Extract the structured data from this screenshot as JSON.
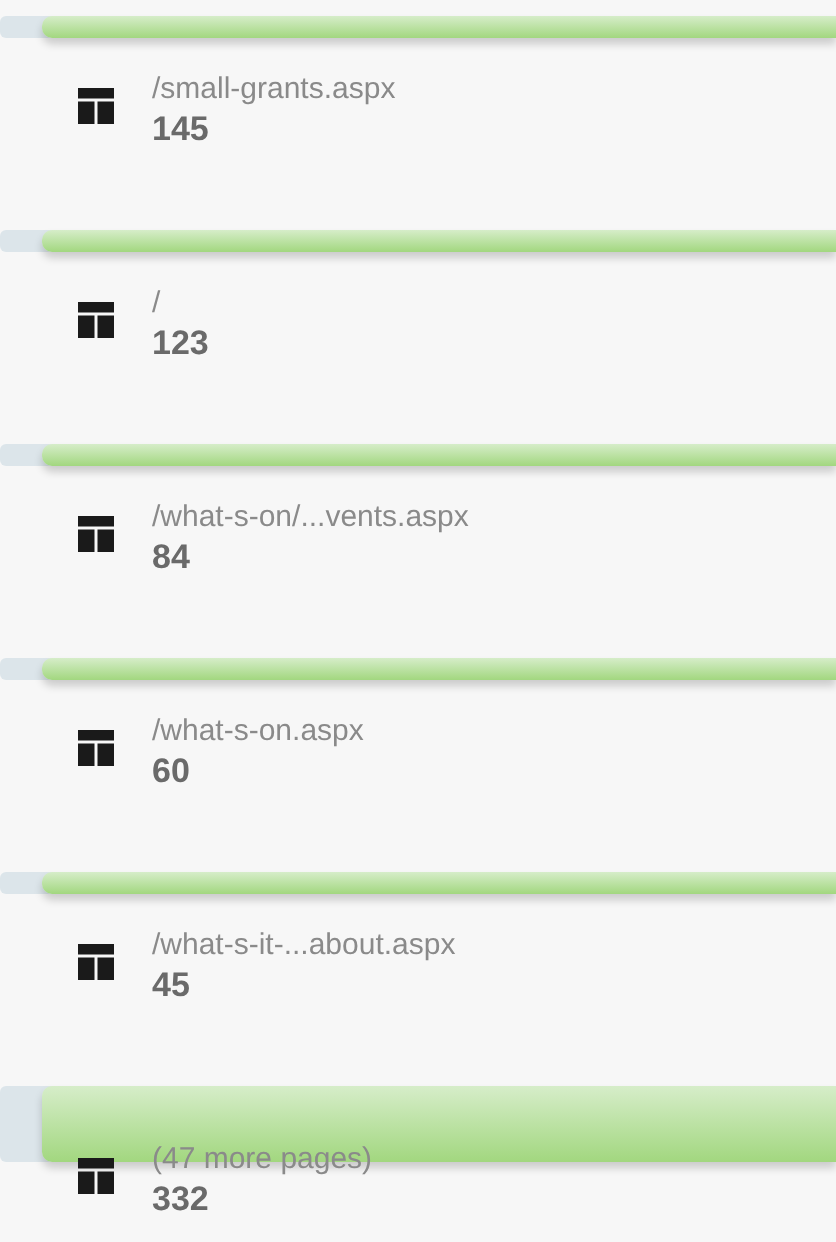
{
  "pages": [
    {
      "path": "/small-grants.aspx",
      "views": "145",
      "kind": "page"
    },
    {
      "path": "/",
      "views": "123",
      "kind": "page"
    },
    {
      "path": "/what-s-on/...vents.aspx",
      "views": "84",
      "kind": "page"
    },
    {
      "path": "/what-s-on.aspx",
      "views": "60",
      "kind": "page"
    },
    {
      "path": "/what-s-it-...about.aspx",
      "views": "45",
      "kind": "page"
    },
    {
      "path": "(47 more pages)",
      "views": "332",
      "kind": "summary"
    }
  ]
}
